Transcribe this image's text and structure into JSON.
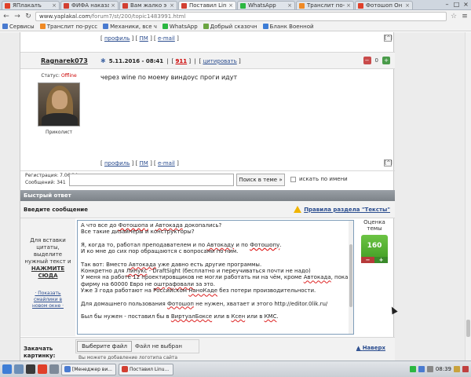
{
  "browser": {
    "tabs": [
      {
        "label": "ЯПлакалъ",
        "color": "#e0402a",
        "active": false
      },
      {
        "label": "ФИФА наказа",
        "color": "#d23f31",
        "active": false
      },
      {
        "label": "Вам жалко э",
        "color": "#d23f31",
        "active": false
      },
      {
        "label": "Поставил Linu",
        "color": "#d23f31",
        "active": true
      },
      {
        "label": "WhatsApp",
        "color": "#2bb741",
        "active": false
      },
      {
        "label": "Транслит по-р",
        "color": "#f08a24",
        "active": false
      },
      {
        "label": "Фотошоп Он",
        "color": "#e0402a",
        "active": false
      }
    ],
    "url_host": "www.yaplakal.com",
    "url_path": "/forum7/st/200/topic1483991.html",
    "bookmarks": [
      {
        "label": "Сервисы",
        "color": "#4a7bd0"
      },
      {
        "label": "Транслит по-русс",
        "color": "#f08a24"
      },
      {
        "label": "Механики, все ч",
        "color": "#4a7bd0"
      },
      {
        "label": "WhatsApp",
        "color": "#2bb741"
      },
      {
        "label": "Добрый сказочн",
        "color": "#6ba542"
      },
      {
        "label": "Бланк Военной",
        "color": "#3d7dd6"
      }
    ]
  },
  "post_links_top": {
    "profile": "профиль",
    "pm": "ПМ",
    "email": "e-mail",
    "up": "[^]"
  },
  "post": {
    "author": "Ragnarek073",
    "date": "5.11.2016 - 08:41",
    "number": "911",
    "quote": "цитировать",
    "rating": "0",
    "status_label": "Статус:",
    "status_value": "Offline",
    "rank": "Приколист",
    "registration": "Регистрация: 7.06.14",
    "messages": "Сообщений: 341",
    "body": "через wine по моему виндоус проги идут"
  },
  "post_links_bottom": {
    "profile": "профиль",
    "pm": "ПМ",
    "email": "e-mail",
    "up": "[^]"
  },
  "search": {
    "button": "Поиск в теме »",
    "checkbox_label": "искать по имени"
  },
  "quick_reply": {
    "title": "Быстрый ответ",
    "compose_label": "Введите сообщение",
    "rules": "Правила раздела \"Тексты\"",
    "hint_1": "Для вставки",
    "hint_2": "цитаты,",
    "hint_3": "выделите",
    "hint_4": "нужный текст и",
    "hint_5": "НАЖМИТЕ",
    "hint_6": "СЮДА",
    "smiles_1": "· Показать",
    "smiles_2": "смайлики в",
    "smiles_3": "новом окне ·",
    "vote_label": "Оценка темы",
    "vote_value": "160",
    "vote_minus": "−",
    "vote_plus": "+"
  },
  "editor_lines": [
    "А что все до Фотошопа и Автокада докопались?",
    "Все такие дизайнеры и конструкторы?",
    "",
    "Я, когда то, работал преподавателем и по Автокаду и по Фотошопу.",
    "И ко мне до сих пор обращаются с вопросами по ним.",
    "",
    "Так вот: Вместо Автокада уже давно есть другие программы.",
    "Конкретно для Линукс - DraftSight (бесплатно и переучиваться почти не надо)",
    "У меня на работе 12 проектировщиков не могли работать ни на чём, кроме Автокада, пока",
    "фирму на 60000 Евро не оштрафовали за это.",
    "Уже 3 года работают на Российском НаноКаде без потери производительности.",
    "",
    "Для домашнего пользования Фотошоп не нужен, хватает и этого http://editor.0lik.ru/",
    "",
    "Был бы нужен - поставил бы в ВиртуалБоксе или в Ксен или в КМС."
  ],
  "attach": {
    "label_1": "Закачать",
    "label_2": "картинку:",
    "file_button": "Выберите файл",
    "file_status": "Файл не выбран",
    "tip": "Вы можете добавление логотипа сайта",
    "back_top": "Наверх"
  },
  "taskbar": {
    "tasks": [
      {
        "label": "[Менеджер ви...",
        "color": "#4a7bd0"
      },
      {
        "label": "Поставил Linu...",
        "color": "#d23f31"
      }
    ],
    "time": "08:39"
  }
}
